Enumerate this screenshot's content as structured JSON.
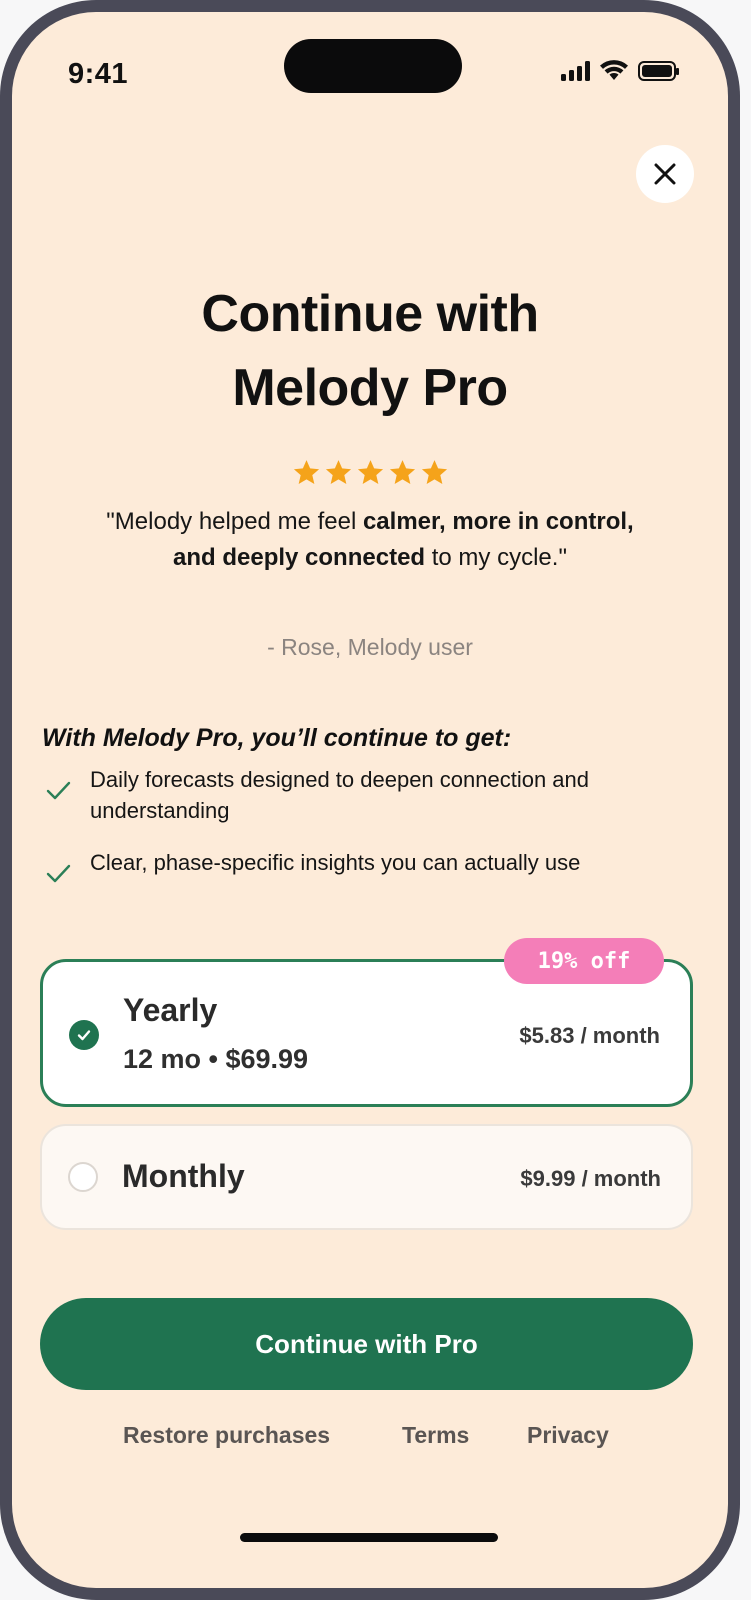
{
  "status_bar": {
    "time": "9:41"
  },
  "close_button": {
    "icon": "close-icon"
  },
  "title": {
    "line1": "Continue with",
    "line2": "Melody Pro"
  },
  "rating": {
    "stars": 5,
    "max": 5,
    "color": "#f5a31a"
  },
  "testimonial": {
    "part1": "\"Melody helped me feel ",
    "bold": "calmer, more in control, and deeply connected",
    "part2": " to my cycle.\"",
    "attribution": "- Rose, Melody user"
  },
  "benefits": {
    "title": "With Melody Pro, you’ll continue to get:",
    "items": [
      "Daily forecasts designed to deepen connection and understanding",
      "Clear, phase-specific insights you can actually use"
    ]
  },
  "plans": {
    "yearly": {
      "name": "Yearly",
      "subtitle": "12 mo • $69.99",
      "price": "$5.83 / month",
      "badge": "19% off",
      "selected": true
    },
    "monthly": {
      "name": "Monthly",
      "price": "$9.99 / month",
      "selected": false
    }
  },
  "cta": {
    "label": "Continue with Pro"
  },
  "footer": {
    "restore": "Restore purchases",
    "terms": "Terms",
    "privacy": "Privacy"
  },
  "colors": {
    "background": "#fdebd9",
    "accent": "#1f7350",
    "badge": "#f47eb8"
  }
}
